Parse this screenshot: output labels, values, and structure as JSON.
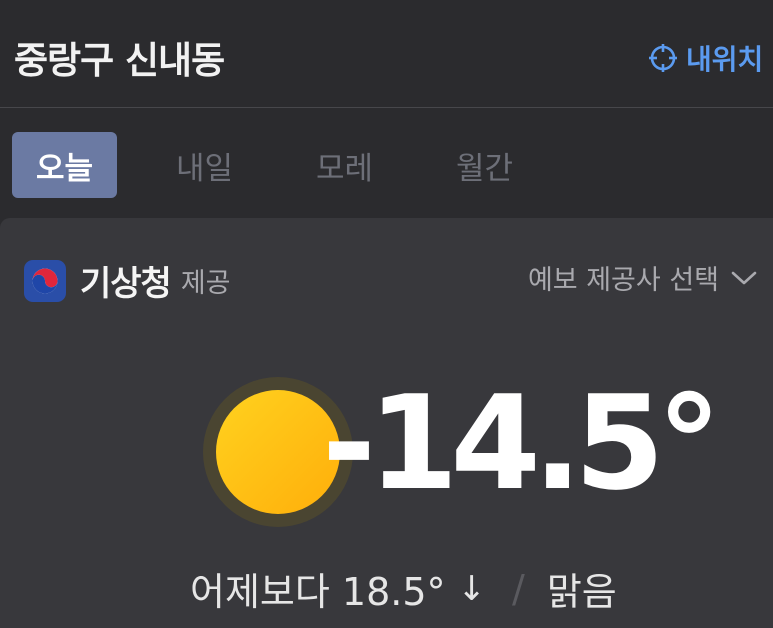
{
  "header": {
    "location": "중랑구 신내동",
    "my_location_label": "내위치",
    "my_location_icon": "crosshair-icon",
    "accent_color": "#5b9bf0"
  },
  "tabs": [
    {
      "label": "오늘",
      "active": true
    },
    {
      "label": "내일",
      "active": false
    },
    {
      "label": "모레",
      "active": false
    },
    {
      "label": "월간",
      "active": false
    }
  ],
  "provider": {
    "name": "기상청",
    "suffix": "제공",
    "select_label": "예보 제공사 선택",
    "logo_icon": "kma-logo-icon",
    "chevron_icon": "chevron-down-icon"
  },
  "weather": {
    "icon": "sun-icon",
    "temperature": "-14.5°",
    "comparison_label": "어제보다 18.5°",
    "comparison_direction": "↓",
    "separator": "/",
    "condition": "맑음"
  }
}
